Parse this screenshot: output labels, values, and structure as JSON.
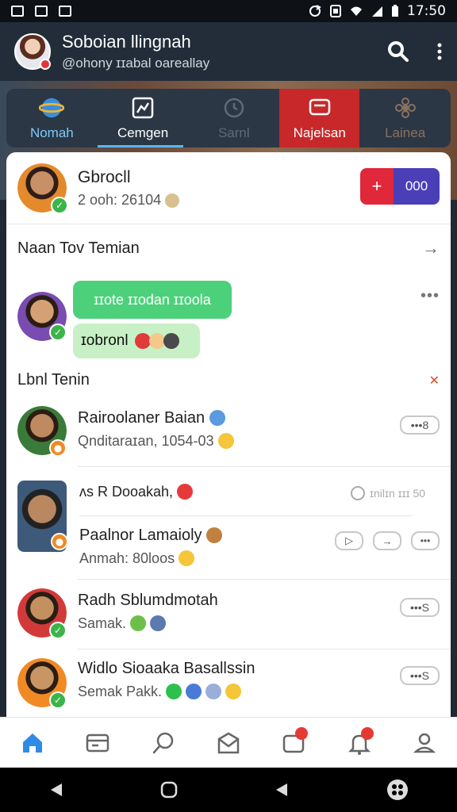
{
  "status_bar": {
    "time": "17:50",
    "left_icons": [
      "notification-icon",
      "sim-icon",
      "mail-icon"
    ],
    "right_icons": [
      "sync-icon",
      "battery-saver-icon",
      "wifi-icon",
      "signal-icon",
      "battery-icon"
    ]
  },
  "header": {
    "title": "Soboian llingnah",
    "subtitle": "@ohony ɪɪabal oareallay"
  },
  "tabs": [
    {
      "label": "Nomah",
      "state": "default"
    },
    {
      "label": "Cemgen",
      "state": "active"
    },
    {
      "label": "Sarnl",
      "state": "dim"
    },
    {
      "label": "Najelsan",
      "state": "highlighted"
    },
    {
      "label": "Lainea",
      "state": "dim"
    }
  ],
  "profile": {
    "name": "Gbrocll",
    "meta": "2 ooh: 26104",
    "action_red_label": "+",
    "action_blue_label": "000"
  },
  "section_one": {
    "label": "Naan Tov Temian"
  },
  "chat": {
    "bubble_green": "ɪɪote ɪɪodan ɪɪoola",
    "bubble_light": "ɪobronl"
  },
  "section_two": {
    "label": "Lbnl Tenin"
  },
  "list": [
    {
      "title": "Rairoolaner Baian",
      "sub": "Qnditaraɪan, 1054-03",
      "pill": "•••8"
    },
    {
      "title": "ʌs  R  Dooakah,",
      "sub": "",
      "pill": "ɪnilɪn  ɪɪɪ 50"
    },
    {
      "title": "Paalnor Lamaioly",
      "sub": "Anmah: 80loos",
      "pill": ""
    },
    {
      "title": "Radh Sblumdmotah",
      "sub": "Samak.",
      "pill": "•••S"
    },
    {
      "title": "Widlo Sioaaka Basallssin",
      "sub": "Semak   Pakk.",
      "pill": "•••S"
    }
  ],
  "colors": {
    "header_bg": "#222d39",
    "accent_blue": "#5ab6f0",
    "tab_red": "#c8282a",
    "green_bubble": "#4cd17a",
    "light_bubble": "#c8f0c6",
    "action_red": "#e0283a",
    "action_blue": "#4b3fb8"
  },
  "bottom_nav": {
    "items": [
      "home-icon",
      "card-icon",
      "search-icon",
      "mail-icon",
      "chat-alert-icon",
      "bell-icon",
      "profile-icon"
    ],
    "badges": {
      "chat-alert-icon": "",
      "bell-icon": ""
    }
  }
}
